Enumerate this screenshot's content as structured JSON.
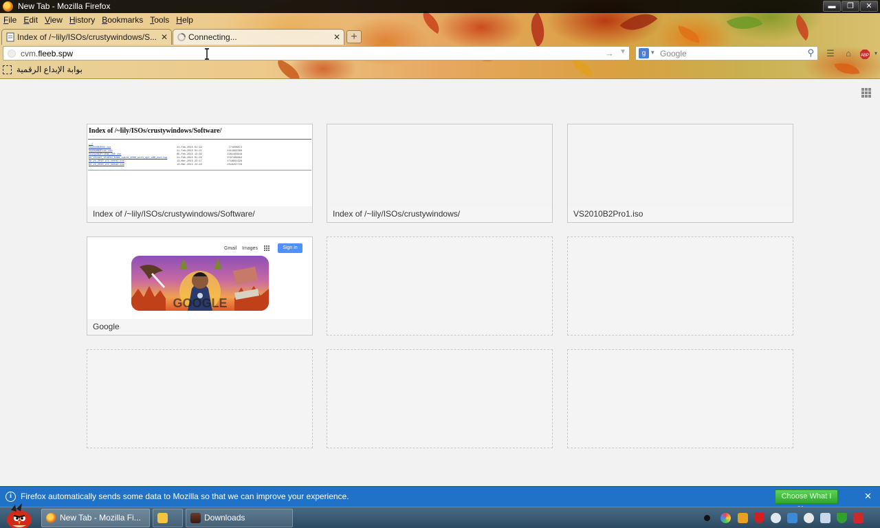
{
  "window": {
    "title": "New Tab - Mozilla Firefox",
    "controls": {
      "minimize": "▬",
      "maximize": "❐",
      "close": "✕"
    }
  },
  "menu": {
    "items": [
      {
        "label": "File",
        "mnemonic": "F",
        "rest": "ile"
      },
      {
        "label": "Edit",
        "mnemonic": "E",
        "rest": "dit"
      },
      {
        "label": "View",
        "mnemonic": "V",
        "rest": "iew"
      },
      {
        "label": "History",
        "mnemonic": "H",
        "rest": "istory"
      },
      {
        "label": "Bookmarks",
        "mnemonic": "B",
        "rest": "ookmarks"
      },
      {
        "label": "Tools",
        "mnemonic": "T",
        "rest": "ools"
      },
      {
        "label": "Help",
        "mnemonic": "H",
        "rest": "elp"
      }
    ]
  },
  "tabs": [
    {
      "label": "Index of /~lily/ISOs/crustywindows/S...",
      "icon": "page-icon",
      "active": false
    },
    {
      "label": "Connecting...",
      "icon": "loading-spinner-icon",
      "active": true
    }
  ],
  "newtab_button": "+",
  "urlbar": {
    "prefix": "cvm.",
    "domain": "fleeb.spw",
    "go": "→",
    "history_dropdown": "▼"
  },
  "searchbar": {
    "engine": "g",
    "placeholder": "Google",
    "icon": "magnifier-icon"
  },
  "toolbar_icons": [
    "bookmarks-menu-icon",
    "home-icon",
    "adblock-plus-icon"
  ],
  "bookmarks_toolbar": {
    "items": [
      {
        "label": "بوابة الإبداع الرقمية",
        "icon": "bookmark-placeholder-icon"
      }
    ]
  },
  "newtab_page": {
    "tiles": [
      {
        "title": "Index of /~lily/ISOs/crustywindows/Software/",
        "thumb": "directory-listing",
        "listing_heading": "Index of /~lily/ISOs/crustywindows/Software/",
        "listing_rows": [
          {
            "name": "../",
            "date": "",
            "size": ""
          },
          {
            "name": "VS2010B2ENU.iso",
            "date": "11-Feb-2015 01:19",
            "size": "771008872"
          },
          {
            "name": "VS2010B2Pro1.iso",
            "date": "11-Feb-2015 01:21",
            "size": "2411962368"
          },
          {
            "name": "VS2010B2ProENU_DVD.iso",
            "date": "05-Feb-2015 13:39",
            "size": "2261403648"
          },
          {
            "name": "en_visual_studio_team_suite_2008_with_sp1_x86_dvd.iso",
            "date": "11-Feb-2015 01:29",
            "size": "3797489664"
          },
          {
            "name": "en_vs_2010_ult_beta1.iso",
            "date": "13-Mar-2015 23:17",
            "size": "2718691328"
          },
          {
            "name": "en_vs_2010_ult_beta2.iso",
            "date": "13-Mar-2015 23:18",
            "size": "2516297728"
          }
        ]
      },
      {
        "title": "Index of /~lily/ISOs/crustywindows/",
        "thumb": "blank"
      },
      {
        "title": "VS2010B2Pro1.iso",
        "thumb": "blank"
      },
      {
        "title": "Google",
        "thumb": "google-home",
        "google_links": {
          "gmail": "Gmail",
          "images": "Images",
          "signin": "Sign in"
        },
        "doodle_word": "GOOGLE"
      },
      {
        "title": "",
        "thumb": "empty"
      },
      {
        "title": "",
        "thumb": "empty"
      },
      {
        "title": "",
        "thumb": "empty"
      },
      {
        "title": "",
        "thumb": "empty"
      },
      {
        "title": "",
        "thumb": "empty"
      }
    ]
  },
  "notification": {
    "message": "Firefox automatically sends some data to Mozilla so that we can improve your experience.",
    "button": "Choose What I Share",
    "close": "✕",
    "icon": "info-icon"
  },
  "taskbar": {
    "buttons": [
      {
        "label": "New Tab - Mozilla Fi...",
        "icon": "firefox-icon"
      },
      {
        "label": "",
        "icon": "app-icon"
      },
      {
        "label": "Downloads",
        "icon": "downloads-folder-icon"
      }
    ],
    "tray_icons": [
      "record-dot-icon",
      "color-picker-icon",
      "media-icon",
      "shield-icon",
      "chat-bubble-icon",
      "network-icon",
      "smiley-icon",
      "display-icon",
      "checkmark-shield-icon",
      "close-red-icon"
    ]
  },
  "colors": {
    "accent_notification": "#1f72c7",
    "choose_button": "#3fbf38",
    "titlebar": "#000000",
    "taskbar": "#3a5a74"
  }
}
